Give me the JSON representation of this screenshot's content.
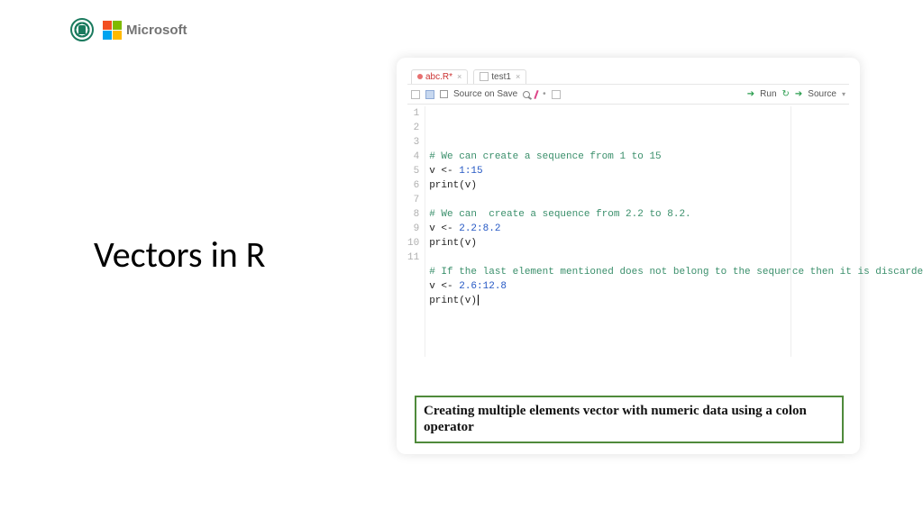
{
  "header": {
    "microsoft_label": "Microsoft"
  },
  "slide": {
    "title": "Vectors in R"
  },
  "editor": {
    "tabs": [
      {
        "label": "abc.R*",
        "active": true
      },
      {
        "label": "test1",
        "active": false
      }
    ],
    "toolbar": {
      "source_on_save": "Source on Save",
      "run": "Run",
      "source": "Source"
    },
    "lines": [
      {
        "n": "1",
        "type": "comment",
        "text": "# We can create a sequence from 1 to 15"
      },
      {
        "n": "2",
        "type": "code_assign",
        "var": "v <- ",
        "val": "1:15"
      },
      {
        "n": "3",
        "type": "print",
        "text": "print(v)"
      },
      {
        "n": "4",
        "type": "blank",
        "text": ""
      },
      {
        "n": "5",
        "type": "comment",
        "text": "# We can  create a sequence from 2.2 to 8.2."
      },
      {
        "n": "6",
        "type": "code_assign",
        "var": "v <- ",
        "val": "2.2:8.2"
      },
      {
        "n": "7",
        "type": "print",
        "text": "print(v)"
      },
      {
        "n": "8",
        "type": "blank",
        "text": ""
      },
      {
        "n": "9",
        "type": "comment",
        "text": "# If the last element mentioned does not belong to the sequence then it is discarded."
      },
      {
        "n": "10",
        "type": "code_assign",
        "var": "v <- ",
        "val": "2.6:12.8"
      },
      {
        "n": "11",
        "type": "print_cursor",
        "text": "print(v)"
      }
    ],
    "caption": "Creating multiple elements vector with numeric data using a colon operator"
  }
}
